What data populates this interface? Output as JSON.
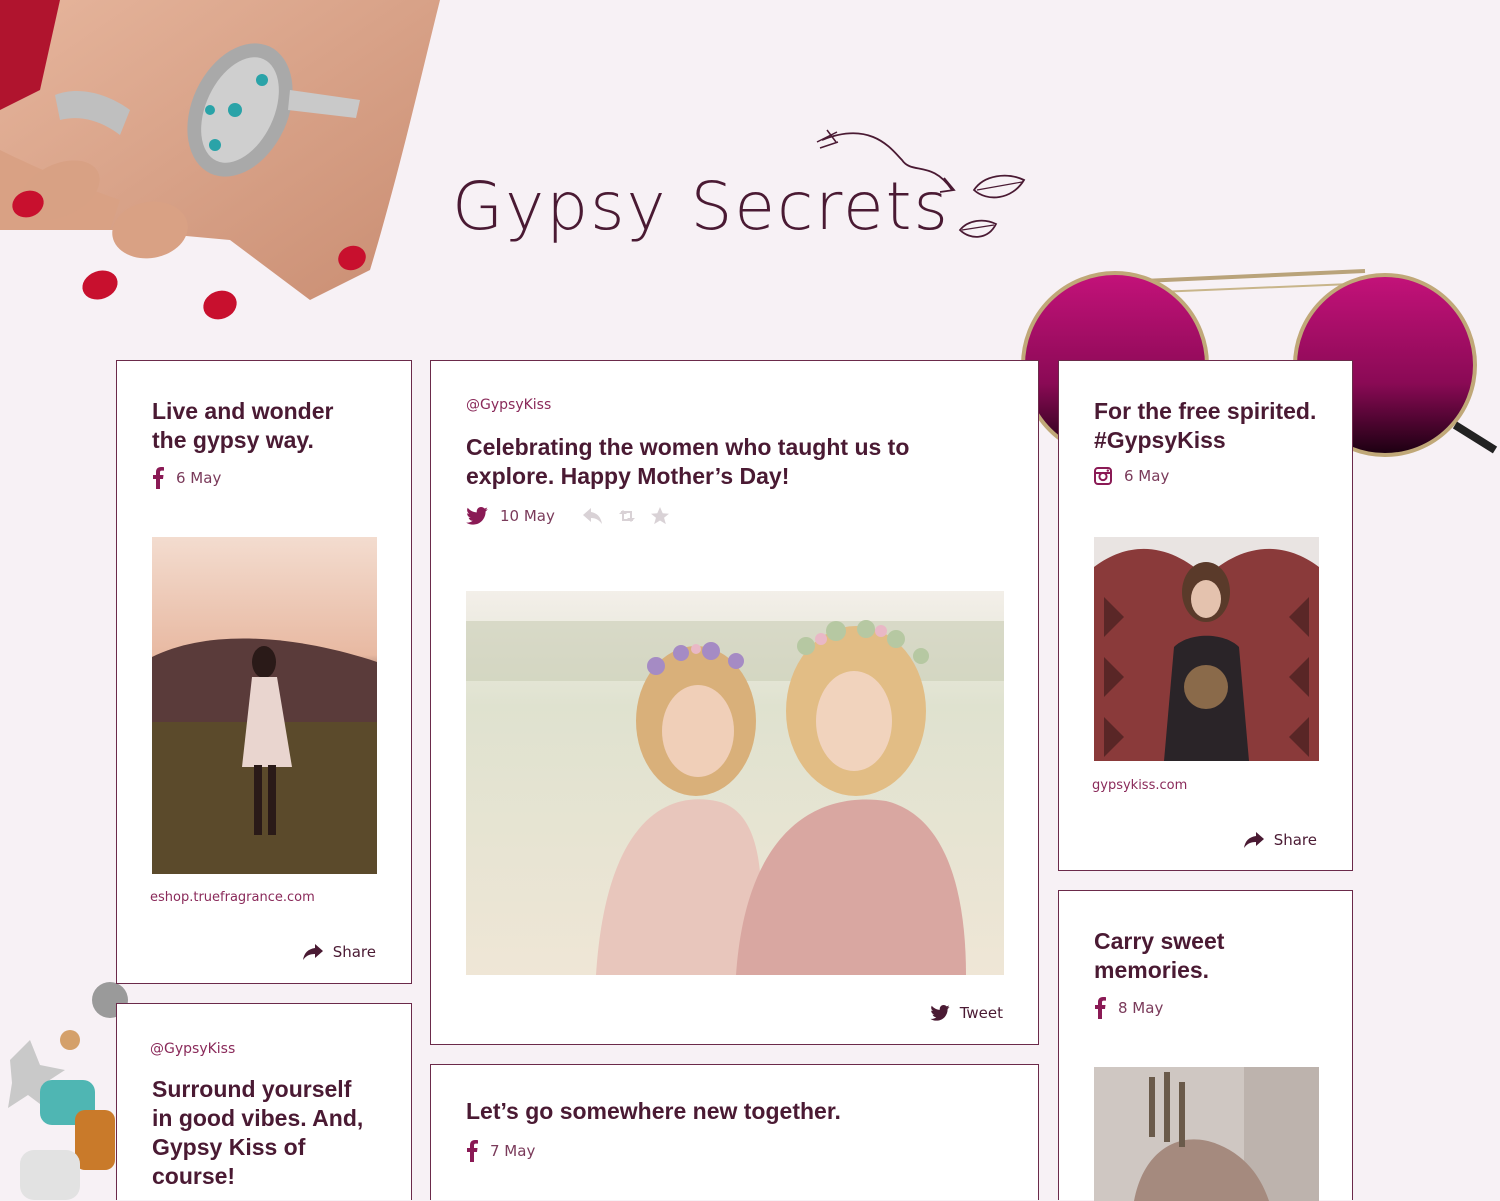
{
  "header": {
    "title": "Gypsy Secrets"
  },
  "colors": {
    "accent": "#8a1a55",
    "text": "#4a1a33",
    "border": "#6b2a4a",
    "background": "#f7f1f5"
  },
  "cards": {
    "card1": {
      "title_line1": "Live and wonder",
      "title_line2": "the gypsy way.",
      "icon": "facebook-icon",
      "date": "6 May",
      "link": "eshop.truefragrance.com",
      "share_label": "Share"
    },
    "card2": {
      "handle": "@GypsyKiss",
      "title_line1": "Celebrating the women who taught us to",
      "title_line2": "explore. Happy Mother’s Day!",
      "icon": "twitter-icon",
      "date": "10 May",
      "tweet_label": "Tweet"
    },
    "card3": {
      "title_line1": "For the free spirited.",
      "title_line2": "#GypsyKiss",
      "icon": "instagram-icon",
      "date": "6 May",
      "link": "gypsykiss.com",
      "share_label": "Share"
    },
    "card4": {
      "handle": "@GypsyKiss",
      "title_line1": "Surround yourself",
      "title_line2": "in good vibes. And,",
      "title_line3": "Gypsy Kiss of",
      "title_line4": "course!"
    },
    "card5": {
      "title": "Let’s go somewhere new together.",
      "icon": "facebook-icon",
      "date": "7 May"
    },
    "card6": {
      "title_line1": "Carry sweet",
      "title_line2": "memories.",
      "icon": "facebook-icon",
      "date": "8 May"
    }
  }
}
